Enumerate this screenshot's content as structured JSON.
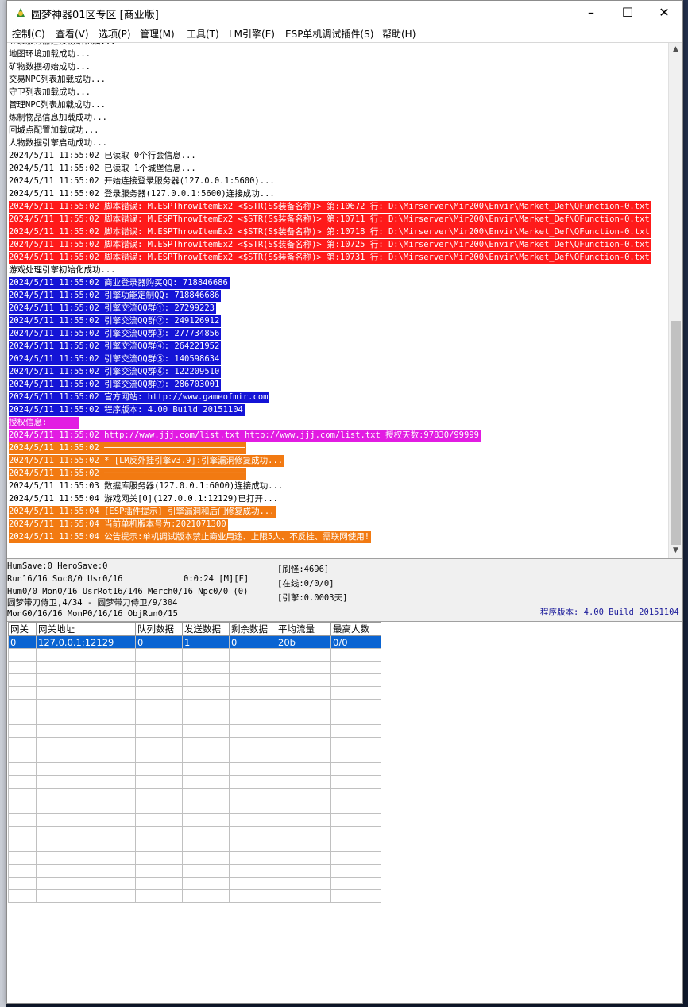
{
  "window": {
    "title": "圆梦神器01区专区 [商业版]"
  },
  "menu": [
    "控制(C)",
    "查看(V)",
    "选项(P)",
    "管理(M)",
    "工具(T)",
    "LM引擎(E)",
    "ESP单机调试插件(S)",
    "帮助(H)"
  ],
  "log": [
    {
      "text": "登录服务器连接初始化成...",
      "style": ""
    },
    {
      "text": "地图环境加载成功...",
      "style": ""
    },
    {
      "text": "矿物数据初始成功...",
      "style": ""
    },
    {
      "text": "交易NPC列表加载成功...",
      "style": ""
    },
    {
      "text": "守卫列表加载成功...",
      "style": ""
    },
    {
      "text": "管理NPC列表加载成功...",
      "style": ""
    },
    {
      "text": "炼制物品信息加载成功...",
      "style": ""
    },
    {
      "text": "回城点配置加载成功...",
      "style": ""
    },
    {
      "text": "人物数据引擎启动成功...",
      "style": ""
    },
    {
      "text": "2024/5/11 11:55:02 已读取 0个行会信息...",
      "style": ""
    },
    {
      "text": "2024/5/11 11:55:02 已读取 1个城堡信息...",
      "style": ""
    },
    {
      "text": "2024/5/11 11:55:02 开始连接登录服务器(127.0.0.1:5600)...",
      "style": ""
    },
    {
      "text": "2024/5/11 11:55:02 登录服务器(127.0.0.1:5600)连接成功...",
      "style": ""
    },
    {
      "text": "2024/5/11 11:55:02 脚本错误: M.ESPThrowItemEx2 <$STR(S$装备名称)> 第:10672 行: D:\\Mirserver\\Mir200\\Envir\\Market_Def\\QFunction-0.txt",
      "style": "red"
    },
    {
      "text": "2024/5/11 11:55:02 脚本错误: M.ESPThrowItemEx2 <$STR(S$装备名称)> 第:10711 行: D:\\Mirserver\\Mir200\\Envir\\Market_Def\\QFunction-0.txt",
      "style": "red"
    },
    {
      "text": "2024/5/11 11:55:02 脚本错误: M.ESPThrowItemEx2 <$STR(S$装备名称)> 第:10718 行: D:\\Mirserver\\Mir200\\Envir\\Market_Def\\QFunction-0.txt",
      "style": "red"
    },
    {
      "text": "2024/5/11 11:55:02 脚本错误: M.ESPThrowItemEx2 <$STR(S$装备名称)> 第:10725 行: D:\\Mirserver\\Mir200\\Envir\\Market_Def\\QFunction-0.txt",
      "style": "red"
    },
    {
      "text": "2024/5/11 11:55:02 脚本错误: M.ESPThrowItemEx2 <$STR(S$装备名称)> 第:10731 行: D:\\Mirserver\\Mir200\\Envir\\Market_Def\\QFunction-0.txt",
      "style": "red"
    },
    {
      "text": "游戏处理引擎初始化成功...",
      "style": ""
    },
    {
      "text": "2024/5/11 11:55:02 商业登录器购买QQ: 718846686",
      "style": "blue"
    },
    {
      "text": "2024/5/11 11:55:02 引擎功能定制QQ: 718846686",
      "style": "blue"
    },
    {
      "text": "2024/5/11 11:55:02 引擎交流QQ群①: 27299223",
      "style": "blue"
    },
    {
      "text": "2024/5/11 11:55:02 引擎交流QQ群②: 249126912",
      "style": "blue"
    },
    {
      "text": "2024/5/11 11:55:02 引擎交流QQ群③: 277734856",
      "style": "blue"
    },
    {
      "text": "2024/5/11 11:55:02 引擎交流QQ群④: 264221952",
      "style": "blue"
    },
    {
      "text": "2024/5/11 11:55:02 引擎交流QQ群⑤: 140598634",
      "style": "blue"
    },
    {
      "text": "2024/5/11 11:55:02 引擎交流QQ群⑥: 122209510",
      "style": "blue"
    },
    {
      "text": "2024/5/11 11:55:02 引擎交流QQ群⑦: 286703001",
      "style": "blue"
    },
    {
      "text": "2024/5/11 11:55:02 官方网站: http://www.gameofmir.com",
      "style": "blue"
    },
    {
      "text": "2024/5/11 11:55:02 程序版本: 4.00 Build 20151104",
      "style": "blue"
    },
    {
      "text": "授权信息:      ",
      "style": "magenta"
    },
    {
      "text": "2024/5/11 11:55:02 http://www.jjj.com/list.txt http://www.jjj.com/list.txt 授权天数:97830/99999",
      "style": "magenta"
    },
    {
      "text": "2024/5/11 11:55:02 ────────────────────────────",
      "style": "orange"
    },
    {
      "text": "2024/5/11 11:55:02 * [LM反外挂引擎v3.9]:引擎漏洞修复成功...",
      "style": "orange"
    },
    {
      "text": "2024/5/11 11:55:02 ────────────────────────────",
      "style": "orange"
    },
    {
      "text": "2024/5/11 11:55:03 数据库服务器(127.0.0.1:6000)连接成功...",
      "style": ""
    },
    {
      "text": "2024/5/11 11:55:04 游戏网关[0](127.0.0.1:12129)已打开...",
      "style": ""
    },
    {
      "text": "2024/5/11 11:55:04 [ESP插件提示] 引擎漏洞和后门修复成功...",
      "style": "orange"
    },
    {
      "text": "2024/5/11 11:55:04 当前单机版本号为:2021071300",
      "style": "orange"
    },
    {
      "text": "2024/5/11 11:55:04 公告提示:单机调试版本禁止商业用途、上限5人、不反挂、需联网使用!",
      "style": "orange"
    }
  ],
  "status": {
    "l1": "HumSave:0 HeroSave:0",
    "l2": "Run16/16 Soc0/0 Usr0/16",
    "l2b": "0:0:24 [M][F]",
    "l3": "Hum0/0 Mon0/16 UsrRot16/146 Merch0/16 Npc0/0 (0)",
    "l4": "圆梦带刀侍卫,4/34 - 圆梦带刀侍卫/9/304",
    "l5": "MonG0/16/16 MonP0/16/16 ObjRun0/15",
    "r1": "[刷怪:4696]",
    "r2": "[在线:0/0/0]",
    "r3": "[引擎:0.0003天]",
    "version": "程序版本: 4.00 Build 20151104"
  },
  "grid": {
    "headers": [
      "网关",
      "网关地址",
      "队列数据",
      "发送数据",
      "剩余数据",
      "平均流量",
      "最高人数"
    ],
    "rows": [
      [
        "0",
        "127.0.0.1:12129",
        "0",
        "1",
        "0",
        "20b",
        "0/0"
      ]
    ],
    "empty_rows": 20
  }
}
